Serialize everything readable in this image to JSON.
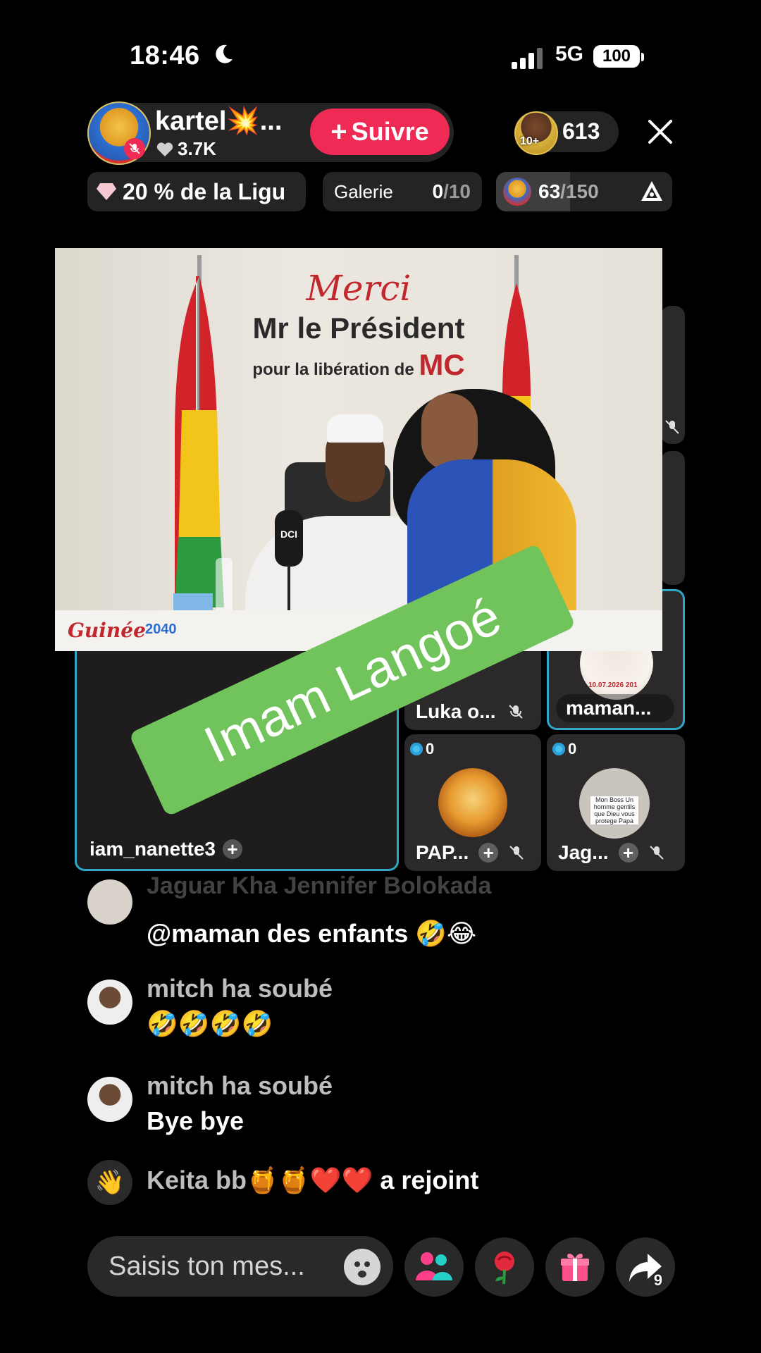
{
  "status_bar": {
    "time": "18:46",
    "network": "5G",
    "battery": "100"
  },
  "host": {
    "name": "kartel💥...",
    "likes": "3.7K"
  },
  "follow_label": "Suivre",
  "viewers": {
    "rank_badge": "10+",
    "count": "613"
  },
  "league": {
    "label": "20 % de la Ligu"
  },
  "gallery": {
    "label": "Galerie",
    "current": "0",
    "total": "/10"
  },
  "goal": {
    "current": "63",
    "total": "/150",
    "progress": 0.42
  },
  "pinned_image": {
    "line1": "Merci",
    "line2": "Mr le Président",
    "line3": "pour la libération de",
    "line3_emphasis": "MC",
    "mic_label": "DCI",
    "brand_left": "Guinée",
    "brand_year": "2040"
  },
  "banner_text": "Imam Langoé",
  "tiles": {
    "main": {
      "name": "iam_nanette3"
    },
    "luka": {
      "name": "Luka o..."
    },
    "maman": {
      "name": "maman..."
    },
    "pap": {
      "name": "PAP...",
      "coins": "0"
    },
    "jag": {
      "name": "Jag...",
      "coins": "0",
      "card_text": "Mon Boss Un homme gentils que Dieu vous protege Papa"
    },
    "maman_card_date": "10.07.2026 201"
  },
  "comments": [
    {
      "name": "Jaguar Kha Jennifer Bolokada",
      "text": "@maman des enfants 🤣😂"
    },
    {
      "name": "mitch ha soubé",
      "text": "🤣🤣🤣🤣"
    },
    {
      "name": "mitch ha soubé",
      "text": "Bye bye"
    }
  ],
  "join_message": {
    "name": "Keita bb🍯🍯❤️❤️",
    "action": "a rejoint"
  },
  "input": {
    "placeholder": "Saisis ton mes..."
  },
  "share_count": "9",
  "colors": {
    "accent": "#EE2A55",
    "banner": "#71C35B",
    "tile_border": "#2FA6C6"
  }
}
